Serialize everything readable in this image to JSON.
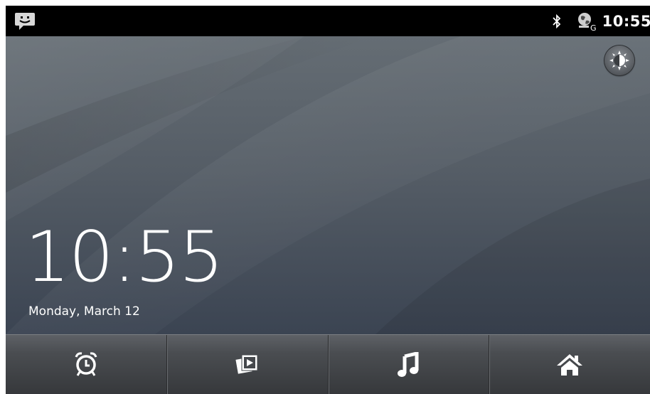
{
  "status_bar": {
    "notification_icon": "chat-smiley-icon",
    "bluetooth_icon": "bluetooth-icon",
    "network_icon": "globe-g-icon",
    "time": "10:55"
  },
  "desk_clock": {
    "brightness_icon": "brightness-icon",
    "time": "10:55",
    "date": "Monday, March 12"
  },
  "nav": {
    "items": [
      {
        "name": "alarm",
        "icon": "alarm-clock-icon"
      },
      {
        "name": "gallery",
        "icon": "gallery-slideshow-icon"
      },
      {
        "name": "music",
        "icon": "music-note-icon"
      },
      {
        "name": "home",
        "icon": "home-icon"
      }
    ]
  },
  "colors": {
    "status_bar_bg": "#000000",
    "wallpaper_top": "#656d74",
    "wallpaper_bottom": "#3b4452",
    "nav_bar_bg": "#4a4d51",
    "text": "#ffffff"
  }
}
